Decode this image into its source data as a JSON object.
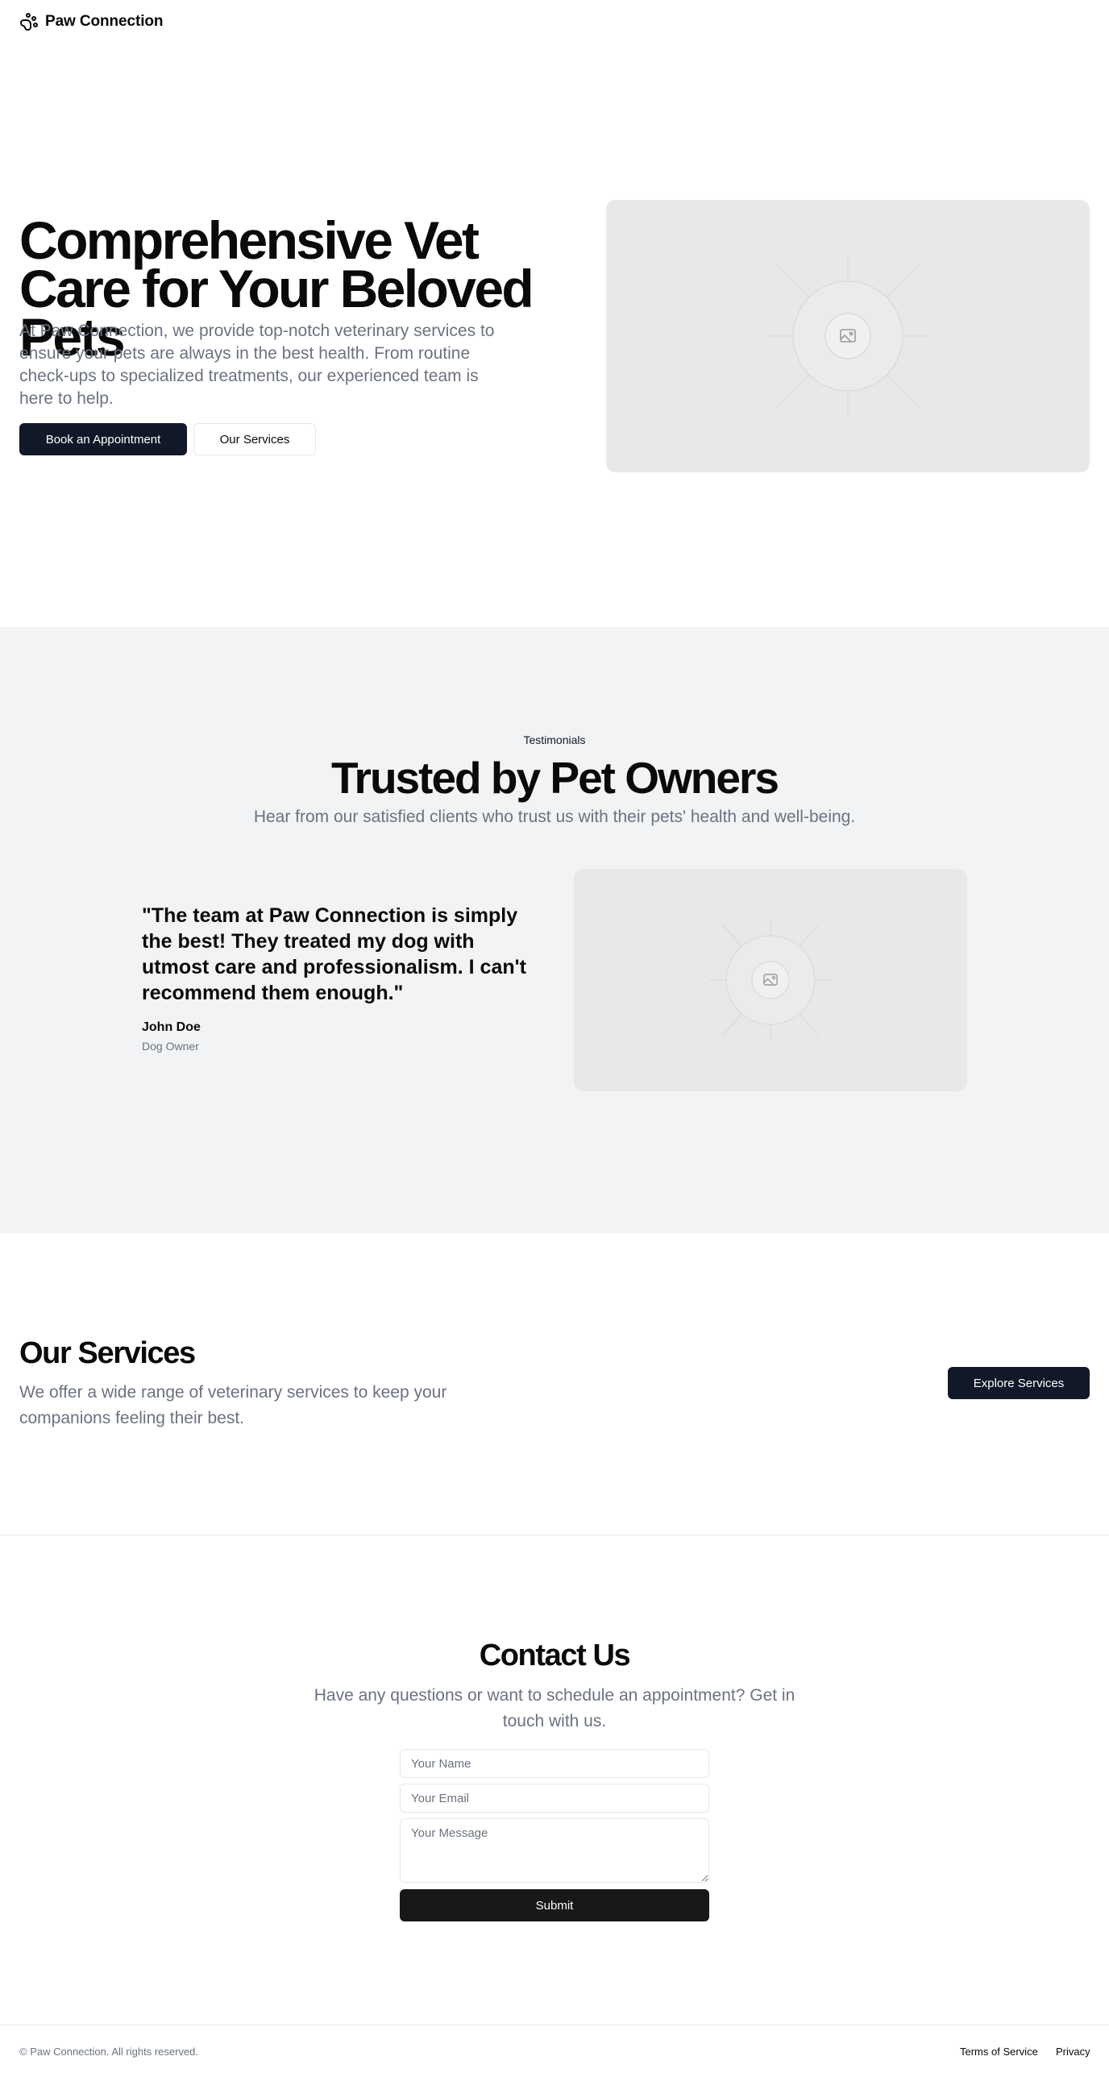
{
  "header": {
    "brand": "Paw Connection",
    "logo_icon": "paw-icon"
  },
  "hero": {
    "title": "Comprehensive Vet Care for Your Beloved Pets",
    "description": "At Paw Connection, we provide top-notch veterinary services to ensure your pets are always in the best health. From routine check-ups to specialized treatments, our experienced team is here to help.",
    "primary_button": "Book an Appointment",
    "secondary_button": "Our Services",
    "image_icon": "image-placeholder-icon"
  },
  "testimonials": {
    "eyebrow": "Testimonials",
    "title": "Trusted by Pet Owners",
    "subtitle": "Hear from our satisfied clients who trust us with their pets' health and well-being.",
    "quote": "\"The team at Paw Connection is simply the best! They treated my dog with utmost care and professionalism. I can't recommend them enough.\"",
    "author": "John Doe",
    "author_role": "Dog Owner",
    "image_icon": "image-placeholder-icon"
  },
  "services": {
    "title": "Our Services",
    "description": "We offer a wide range of veterinary services to keep your companions feeling their best.",
    "button": "Explore Services"
  },
  "contact": {
    "title": "Contact Us",
    "subtitle": "Have any questions or want to schedule an appointment? Get in touch with us.",
    "name_placeholder": "Your Name",
    "email_placeholder": "Your Email",
    "message_placeholder": "Your Message",
    "submit": "Submit"
  },
  "footer": {
    "copyright": "© Paw Connection. All rights reserved.",
    "links": [
      "Terms of Service",
      "Privacy"
    ]
  },
  "colors": {
    "primary_button": "#111827",
    "submit_button": "#18181b",
    "muted_text": "#6b7280",
    "section_bg": "#f2f3f5",
    "placeholder_bg": "#e8e8e8"
  }
}
